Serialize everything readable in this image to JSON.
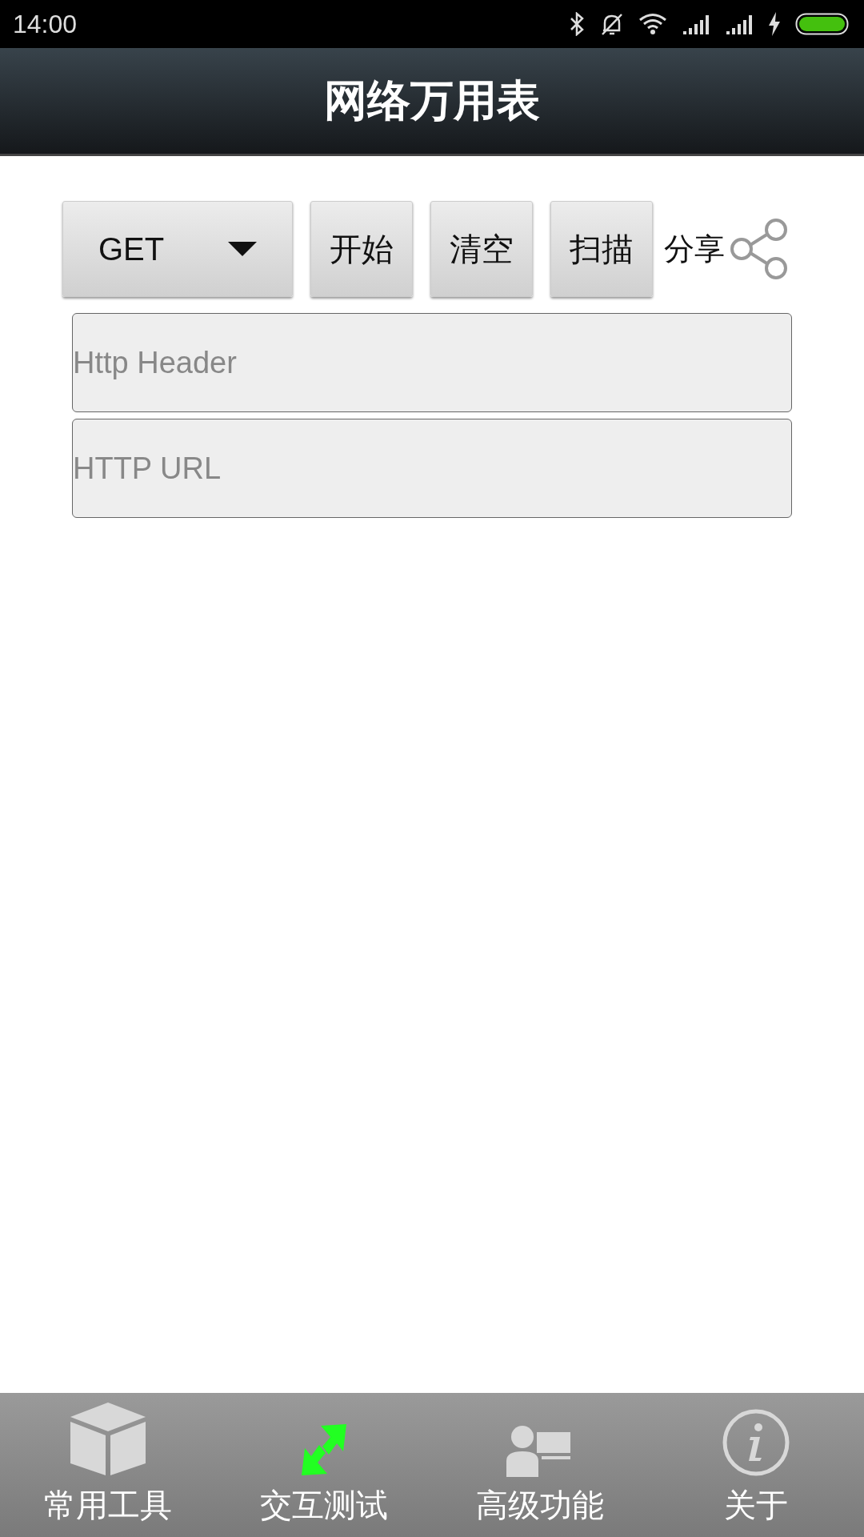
{
  "status_bar": {
    "time": "14:00"
  },
  "app_bar": {
    "title": "网络万用表"
  },
  "toolbar": {
    "method": "GET",
    "buttons": [
      "开始",
      "清空",
      "扫描"
    ],
    "share_label": "分享"
  },
  "fields": [
    {
      "placeholder": "Http Header"
    },
    {
      "placeholder": "HTTP URL"
    }
  ],
  "tabs": [
    {
      "label": "常用工具",
      "kind": "box",
      "selected": false
    },
    {
      "label": "交互测试",
      "kind": "arrows",
      "selected": true
    },
    {
      "label": "高级功能",
      "kind": "person",
      "selected": false
    },
    {
      "label": "关于",
      "kind": "info",
      "selected": false
    }
  ]
}
